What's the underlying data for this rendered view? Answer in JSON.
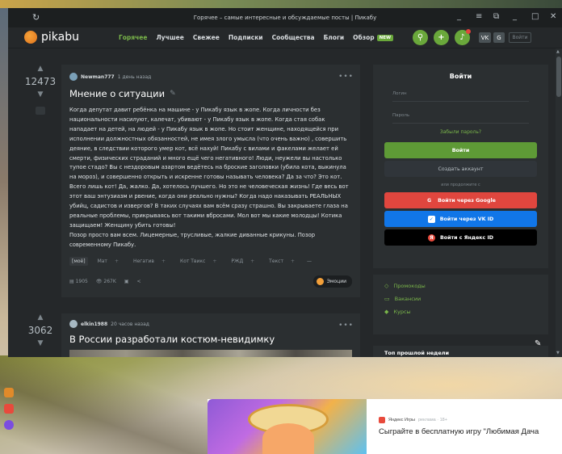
{
  "window": {
    "title": "Горячее – самые интересные и обсуждаемые посты | Пикабу"
  },
  "site": {
    "logo_text": "pikabu",
    "nav": [
      "Горячее",
      "Лучшее",
      "Свежее",
      "Подписки",
      "Сообщества",
      "Блоги",
      "Обзор"
    ],
    "nav_active": "Горячее",
    "new_badge": "NEW",
    "login_btn": "Войти",
    "vk": "VK",
    "g": "G"
  },
  "posts": [
    {
      "rating": "12473",
      "author": "Newman777",
      "time": "1 день назад",
      "title": "Мнение о ситуации",
      "body": "Когда депутат давит ребёнка на машине - у Пикабу язык в жопе. Когда личности без национальности насилуют, калечат, убивают - у Пикабу язык в жопе. Когда стая собак нападает на детей, на людей - у Пикабу язык в жопе. Но стоит женщине, находящейся при исполнении должностных обязанностей, не имея злого умысла (что очень важно) , совершить деяние, в следствии которого умер кот, всё нахуй! Пикабу с вилами и факелами желает ей смерти, физических страданий и много ещё чего негативного! Люди, неужели вы настолько тупое стадо? Вы с нездоровым азартом ведётесь на броские заголовки (убила кота, выкинула на мороз), и совершенно открыть и искренне готовы называть человека? Да за что? Это кот. Всего лишь кот! Да, жалко. Да, хотелось лучшего. Но это не человеческая жизнь! Где весь вот этот ваш энтузиазм и рвение, когда они реально нужны? Когда надо наказывать РЕАЛЬНЫХ убийц, садистов и извергов? В таких случаях вам всём сразу страшно. Вы закрываете глаза на реальные проблемы, прикрываясь вот такими вбросами. Мол вот мы какие молодцы! Котика защищаем! Женщину убить готовы!",
      "body2": "Позор просто вам всем. Лицемерные, трусливые, жалкие диванные крикуны. Позор современному Пикабу.",
      "tags": [
        "[моё]",
        "Мат",
        "Негатив",
        "Кот Твикс",
        "РЖД",
        "Текст",
        "—"
      ],
      "comments": "1905",
      "views": "267K",
      "emo_label": "Эмоции"
    },
    {
      "rating": "3062",
      "author": "elkin1988",
      "time": "20 часов назад",
      "title": "В России разработали костюм-невидимку"
    }
  ],
  "sidebar": {
    "title": "Войти",
    "login_placeholder": "Логин",
    "password_placeholder": "Пароль",
    "forgot": "Забыли пароль?",
    "login_button": "Войти",
    "create_button": "Создать аккаунт",
    "or_text": "или продолжите с",
    "google_button": "Войти через Google",
    "vk_button": "Войти через VK ID",
    "yandex_button": "Войти с Яндекс ID",
    "links": [
      "Промокоды",
      "Вакансии",
      "Курсы"
    ],
    "top_week": "Топ прошлой недели"
  },
  "ad": {
    "brand": "Яндекс Игры",
    "tag": "реклама · 18+",
    "title": "Сыграйте в бесплатную игру \"Любимая Дача"
  },
  "colors": {
    "accent_green": "#6aa83b",
    "google_red": "#e0463e",
    "vk_blue": "#1176e8",
    "bg_dark": "#25282a"
  }
}
